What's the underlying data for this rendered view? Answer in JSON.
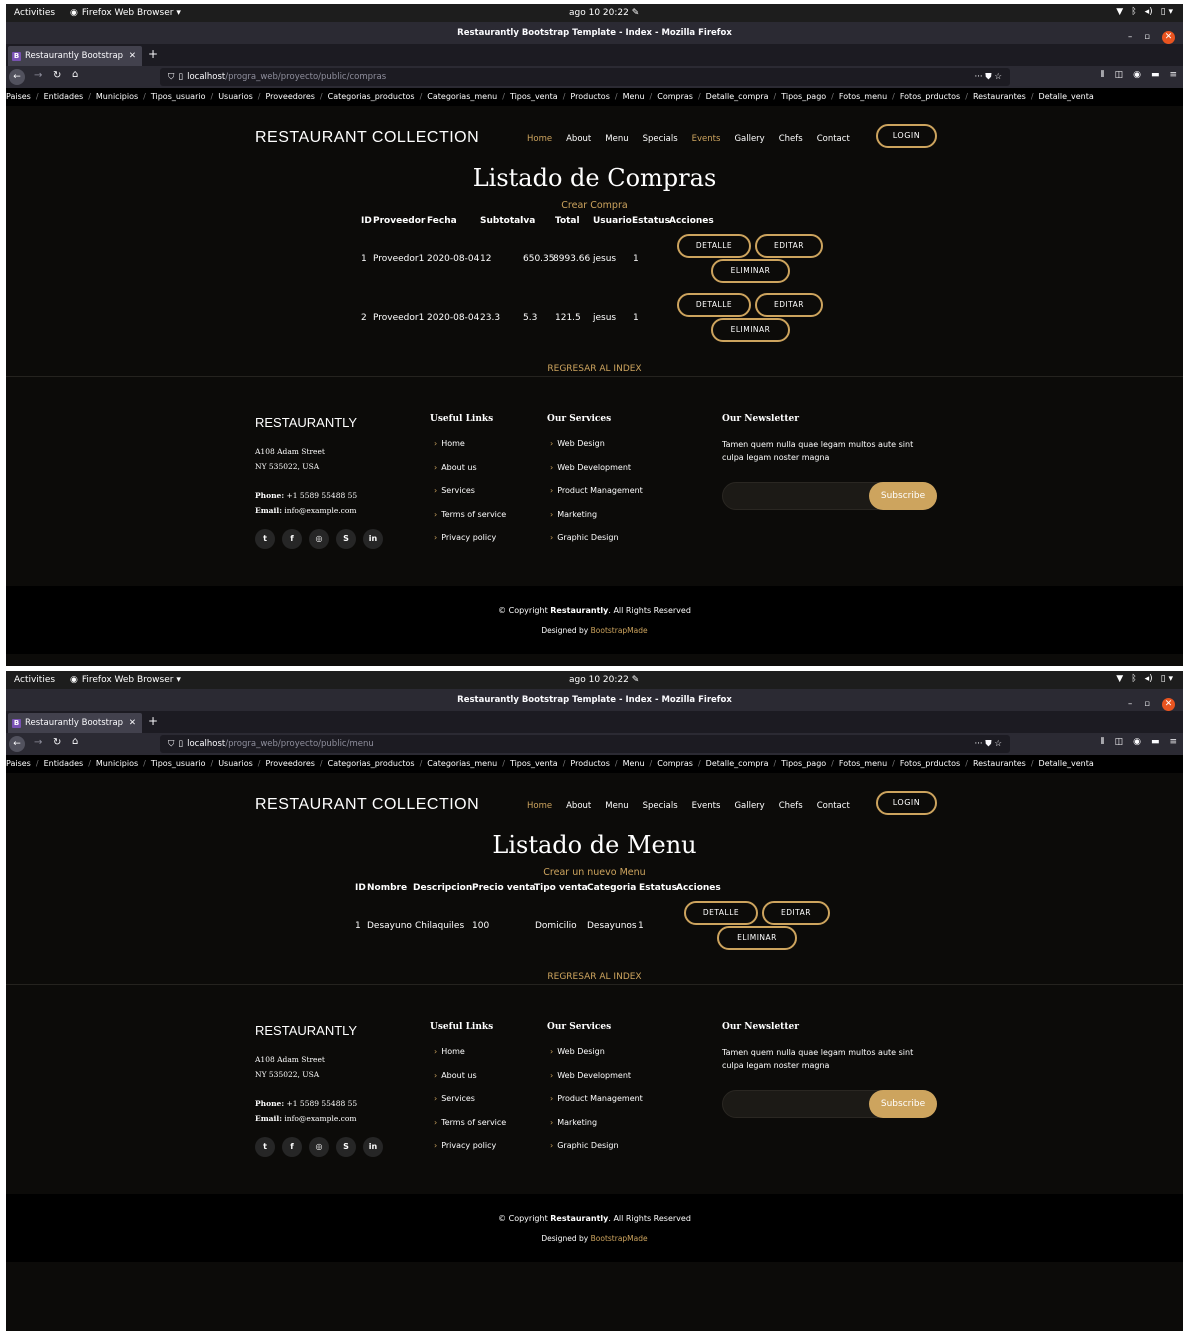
{
  "os": {
    "activities": "Activities",
    "app_menu": "Firefox Web Browser ▾",
    "clock": "ago 10  20:22"
  },
  "browser": {
    "window_title": "Restaurantly Bootstrap Template - Index - Mozilla Firefox",
    "tab_title": "Restaurantly Bootstrap",
    "favicon_letter": "B",
    "new_tab": "+",
    "url_host": "localhost",
    "url_path_compras": "/progra_web/proyecto/public/compras",
    "url_path_menu": "/progra_web/proyecto/public/menu"
  },
  "crumbs": [
    "Paises",
    "Entidades",
    "Municipios",
    "Tipos_usuario",
    "Usuarios",
    "Proveedores",
    "Categorias_productos",
    "Categorias_menu",
    "Tipos_venta",
    "Productos",
    "Menu",
    "Compras",
    "Detalle_compra",
    "Tipos_pago",
    "Fotos_menu",
    "Fotos_prductos",
    "Restaurantes",
    "Detalle_venta"
  ],
  "header": {
    "brand": "RESTAURANT COLLECTION",
    "nav": [
      "Home",
      "About",
      "Menu",
      "Specials",
      "Events",
      "Gallery",
      "Chefs",
      "Contact"
    ],
    "login": "LOGIN"
  },
  "compras": {
    "title": "Listado de Compras",
    "create_link": "Crear Compra",
    "columns": [
      "ID",
      "Proveedor",
      "Fecha",
      "Subtotal",
      "Iva",
      "Total",
      "Usuario",
      "Estatus",
      "Acciones"
    ],
    "rows": [
      {
        "id": "1",
        "proveedor": "Proveedor1",
        "fecha": "2020-08-04",
        "subtotal": "12",
        "iva": "650.35",
        "total": "8993.66",
        "usuario": "jesus",
        "estatus": "1"
      },
      {
        "id": "2",
        "proveedor": "Proveedor1",
        "fecha": "2020-08-04",
        "subtotal": "23.3",
        "iva": "5.3",
        "total": "121.5",
        "usuario": "jesus",
        "estatus": "1"
      }
    ],
    "back_link": "REGRESAR AL INDEX"
  },
  "menu_page": {
    "title": "Listado de Menu",
    "create_link": "Crear un nuevo Menu",
    "columns": [
      "ID",
      "Nombre",
      "Descripcion",
      "Precio venta",
      "Tipo venta",
      "Categoria",
      "Estatus",
      "Acciones"
    ],
    "rows": [
      {
        "id": "1",
        "nombre": "Desayuno",
        "descripcion": "Chilaquiles",
        "precio": "100",
        "tipo": "Domicilio",
        "categoria": "Desayunos",
        "estatus": "1"
      }
    ],
    "back_link": "REGRESAR AL INDEX"
  },
  "actions": {
    "detalle": "DETALLE",
    "editar": "EDITAR",
    "eliminar": "ELIMINAR"
  },
  "footer": {
    "brand": "RESTAURANTLY",
    "address1": "A108 Adam Street",
    "address2": "NY 535022, USA",
    "phone_label": "Phone:",
    "phone": " +1 5589 55488 55",
    "email_label": "Email:",
    "email": " info@example.com",
    "useful_title": "Useful Links",
    "useful": [
      "Home",
      "About us",
      "Services",
      "Terms of service",
      "Privacy policy"
    ],
    "services_title": "Our Services",
    "services": [
      "Web Design",
      "Web Development",
      "Product Management",
      "Marketing",
      "Graphic Design"
    ],
    "newsletter_title": "Our Newsletter",
    "newsletter_text": "Tamen quem nulla quae legam multos aute sint culpa legam noster magna",
    "subscribe": "Subscribe",
    "social": [
      "twitter-icon",
      "facebook-icon",
      "instagram-icon",
      "skype-icon",
      "linkedin-icon"
    ],
    "copyright_pre": "© Copyright ",
    "copyright_brand": "Restaurantly",
    "copyright_post": ". All Rights Reserved",
    "designed_pre": "Designed by ",
    "designed_by": "BootstrapMade"
  },
  "colors": {
    "accent": "#cda45e",
    "background": "#0c0b09"
  }
}
